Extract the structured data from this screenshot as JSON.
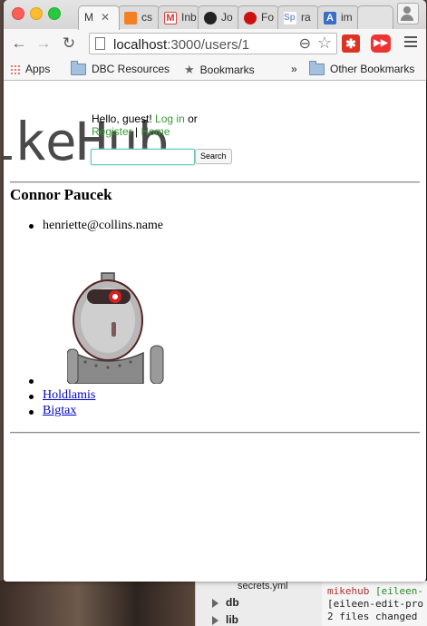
{
  "browser": {
    "tabs": [
      {
        "label": "M",
        "active": true
      },
      {
        "label": "cs"
      },
      {
        "label": "Inb"
      },
      {
        "label": "Jo"
      },
      {
        "label": "Fo"
      },
      {
        "label": "ra"
      },
      {
        "label": "im"
      }
    ],
    "url_host": "localhost",
    "url_path": ":3000/users/1",
    "bookmarks": {
      "apps": "Apps",
      "dbc": "DBC Resources",
      "bookmarks": "Bookmarks",
      "overflow": "»",
      "other": "Other Bookmarks"
    }
  },
  "page": {
    "logo": "ikeHub",
    "greeting": "Hello, guest!",
    "login": "Log in",
    "or": "or",
    "register": "Register",
    "separator": "|",
    "home": "Home",
    "search_value": "",
    "search_button": "Search",
    "user_name": "Connor Paucek",
    "email": "henriette@collins.name",
    "links": [
      "Holdlamis",
      "Bigtax"
    ]
  },
  "desktop": {
    "finder_file": "secrets.yml",
    "finder_db": "db",
    "finder_lib": "lib",
    "term_line1_prompt": "mikehub",
    "term_line1_branch": "[eileen-",
    "term_line2": "[eileen-edit-pro",
    "term_line3": " 2 files changed"
  }
}
